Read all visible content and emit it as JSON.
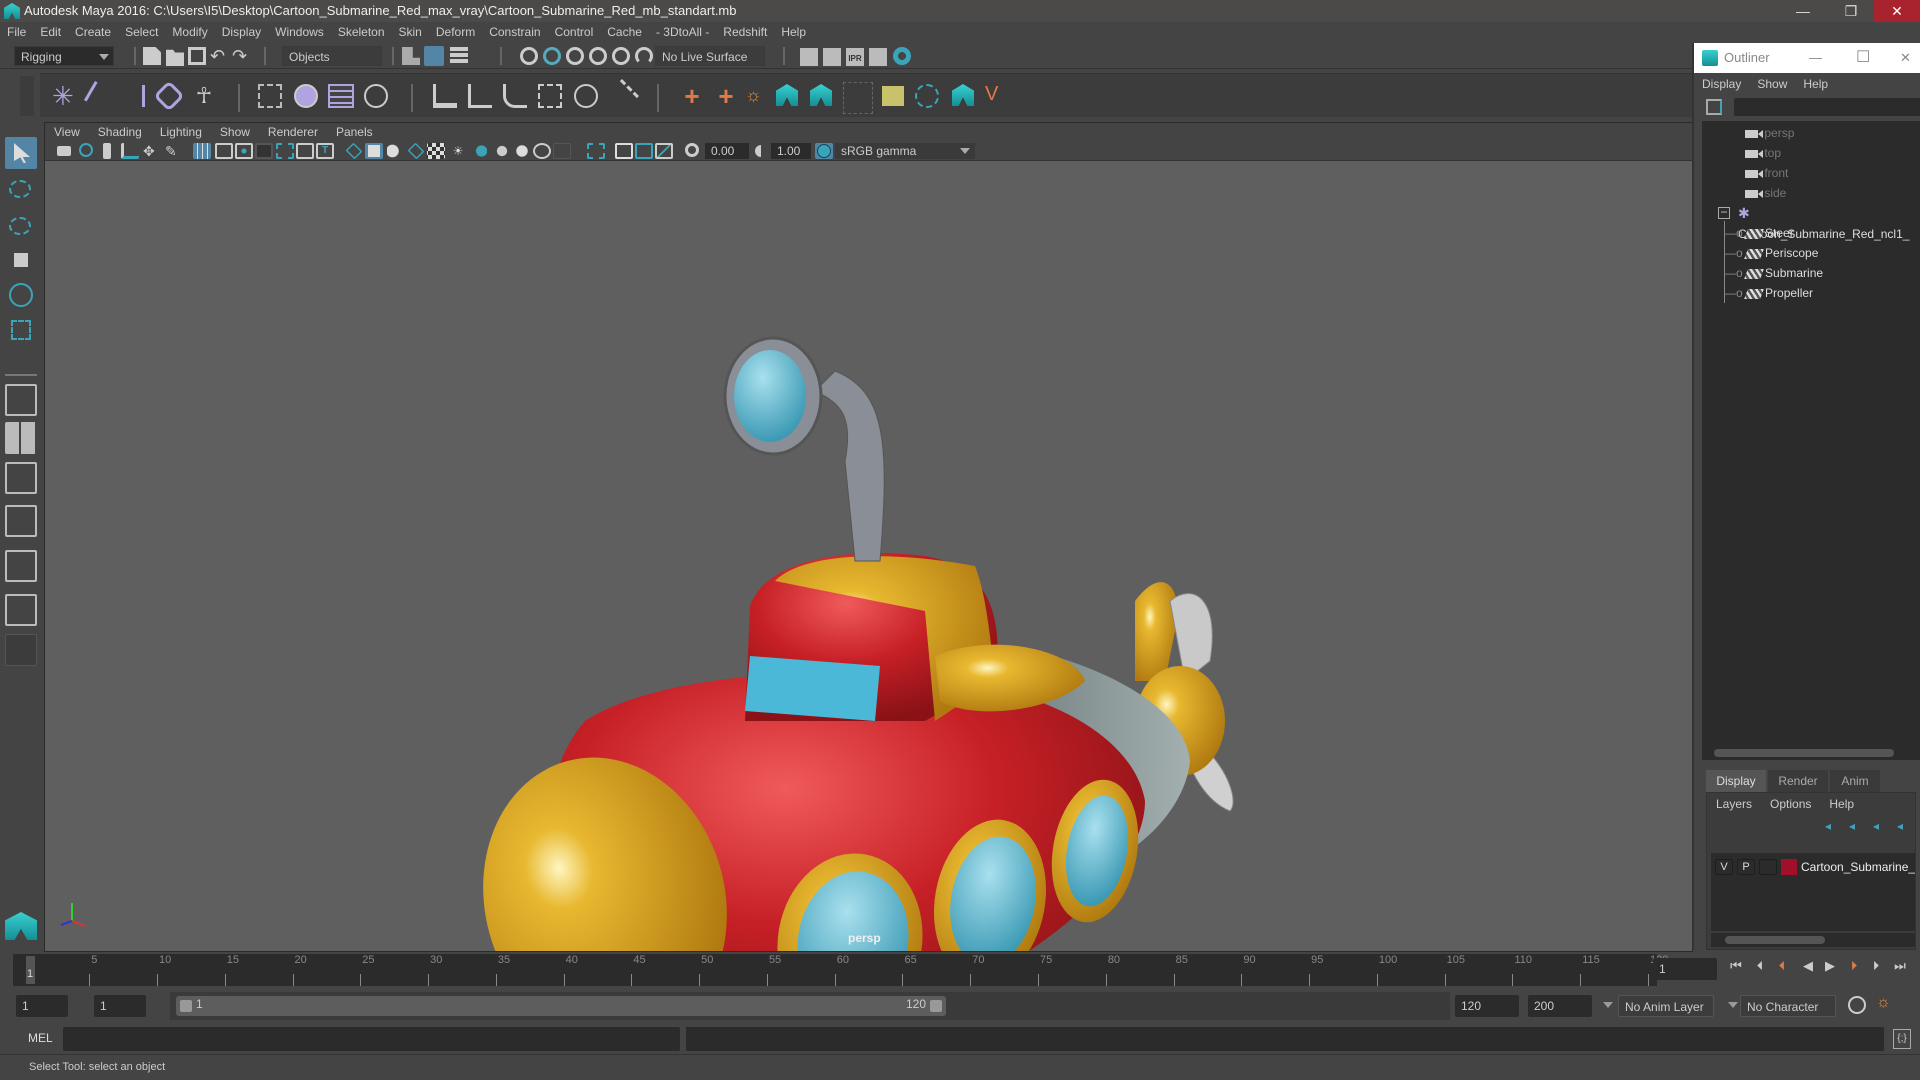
{
  "app": {
    "title": "Autodesk Maya 2016: C:\\Users\\I5\\Desktop\\Cartoon_Submarine_Red_max_vray\\Cartoon_Submarine_Red_mb_standart.mb",
    "minimize": "—",
    "restore": "❐",
    "close": "✕"
  },
  "menubar": [
    "File",
    "Edit",
    "Create",
    "Select",
    "Modify",
    "Display",
    "Windows",
    "Skeleton",
    "Skin",
    "Deform",
    "Constrain",
    "Control",
    "Cache",
    "- 3DtoAll -",
    "Redshift",
    "Help"
  ],
  "statusline": {
    "menuset": "Rigging",
    "selection_mode": "Objects",
    "live_surface": "No Live Surface"
  },
  "shelf": {
    "icons": [
      "joint-tool-icon",
      "ik-handle-icon",
      "ik-spline-icon",
      "insert-joint-icon",
      "humanik-icon",
      "paint-weights-icon",
      "smooth-bind-icon",
      "lattice-icon",
      "cluster-icon",
      "parent-constraint-icon",
      "point-constraint-icon",
      "orient-constraint-icon",
      "scale-constraint-icon",
      "aim-constraint-icon",
      "pole-vector-icon",
      "locator-icon",
      "parent-locator-icon",
      "character-icon",
      "maya-logo-icon",
      "maya-logo-icon-2",
      "empty-slot",
      "set-driven-icon",
      "paint-select-icon",
      "maya-logo-icon-3",
      "curve-icon"
    ]
  },
  "viewport": {
    "menu": [
      "View",
      "Shading",
      "Lighting",
      "Show",
      "Renderer",
      "Panels"
    ],
    "exposure": "0.00",
    "gamma": "1.00",
    "color_space": "sRGB gamma",
    "camera_label": "persp"
  },
  "outliner": {
    "title": "Outliner",
    "menu": [
      "Display",
      "Show",
      "Help"
    ],
    "cameras": [
      "persp",
      "top",
      "front",
      "side"
    ],
    "group": "Cartoon_Submarine_Red_ncl1_",
    "children": [
      "Steer",
      "Periscope",
      "Submarine",
      "Propeller"
    ]
  },
  "layers": {
    "tabs": [
      "Display",
      "Render",
      "Anim"
    ],
    "menu": [
      "Layers",
      "Options",
      "Help"
    ],
    "layer": {
      "v": "V",
      "p": "P",
      "color": "#a0102a",
      "name": "Cartoon_Submarine_R"
    }
  },
  "timeline": {
    "ticks": [
      "5",
      "10",
      "15",
      "20",
      "25",
      "30",
      "35",
      "40",
      "45",
      "50",
      "55",
      "60",
      "65",
      "70",
      "75",
      "80",
      "85",
      "90",
      "95",
      "100",
      "105",
      "110",
      "115",
      "120"
    ],
    "current_frame_marker": "1",
    "current_frame": "1"
  },
  "range": {
    "start": "1",
    "playback_start": "1",
    "slider_start": "1",
    "slider_end": "120",
    "playback_end": "120",
    "end": "200",
    "anim_layer": "No Anim Layer",
    "character_set": "No Character Set"
  },
  "mel": {
    "label": "MEL"
  },
  "helpline": {
    "text": "Select Tool: select an object"
  }
}
